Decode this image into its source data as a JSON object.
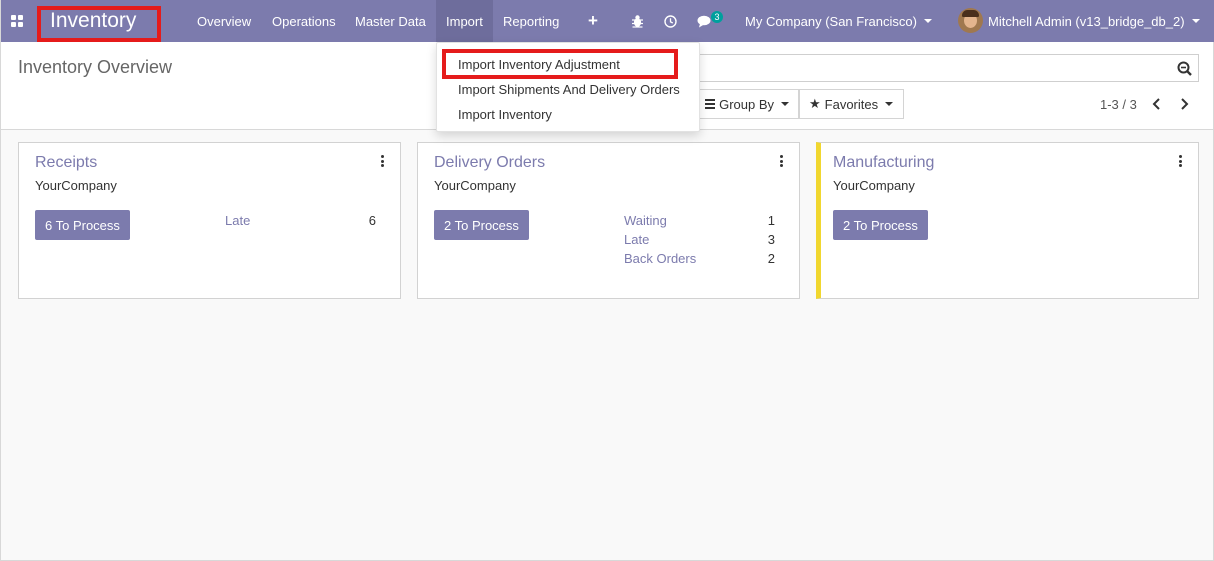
{
  "navbar": {
    "brand": "Inventory",
    "menu": [
      "Overview",
      "Operations",
      "Master Data",
      "Import",
      "Reporting"
    ],
    "active_menu": "Import",
    "chat_badge": "3",
    "company": "My Company (San Francisco)",
    "user": "Mitchell Admin (v13_bridge_db_2)",
    "bg_color": "#7c7bad"
  },
  "control_panel": {
    "title": "Inventory Overview",
    "group_by_label": "Group By",
    "favorites_label": "Favorites",
    "pager": "1-3 / 3"
  },
  "import_dropdown": {
    "items": [
      "Import Inventory Adjustment",
      "Import Shipments And Delivery Orders",
      "Import Inventory"
    ]
  },
  "cards": [
    {
      "title": "Receipts",
      "company": "YourCompany",
      "button": "6 To Process",
      "stats": [
        {
          "label": "Late",
          "value": "6"
        }
      ]
    },
    {
      "title": "Delivery Orders",
      "company": "YourCompany",
      "button": "2 To Process",
      "stats": [
        {
          "label": "Waiting",
          "value": "1"
        },
        {
          "label": "Late",
          "value": "3"
        },
        {
          "label": "Back Orders",
          "value": "2"
        }
      ]
    },
    {
      "title": "Manufacturing",
      "company": "YourCompany",
      "button": "2 To Process",
      "stats": [],
      "accent_color": "#f1d72f"
    }
  ]
}
